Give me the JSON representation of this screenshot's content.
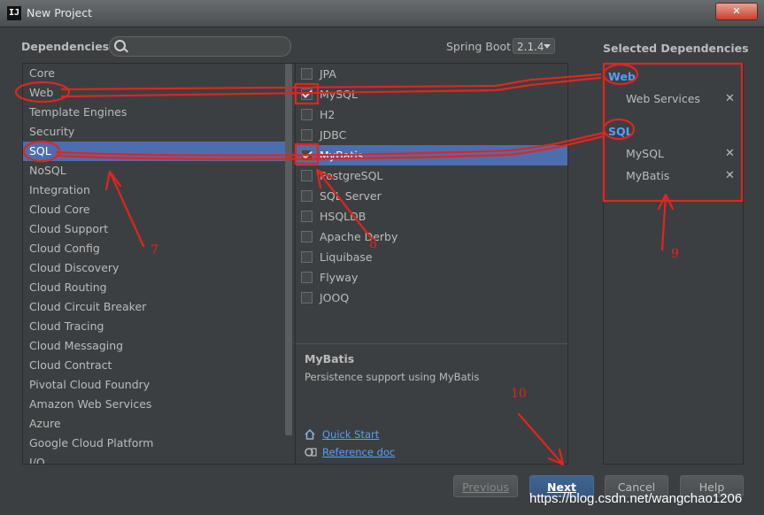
{
  "window": {
    "title": "New Project",
    "icon_text": "IJ",
    "close_label": "✕"
  },
  "header": {
    "dependencies_label": "Dependencies",
    "search_placeholder": "",
    "spring_boot_label": "Spring Boot",
    "spring_boot_version": "2.1.4"
  },
  "categories": [
    "Core",
    "Web",
    "Template Engines",
    "Security",
    "SQL",
    "NoSQL",
    "Integration",
    "Cloud Core",
    "Cloud Support",
    "Cloud Config",
    "Cloud Discovery",
    "Cloud Routing",
    "Cloud Circuit Breaker",
    "Cloud Tracing",
    "Cloud Messaging",
    "Cloud Contract",
    "Pivotal Cloud Foundry",
    "Amazon Web Services",
    "Azure",
    "Google Cloud Platform",
    "I/O"
  ],
  "selected_category": "SQL",
  "options": [
    {
      "label": "JPA",
      "checked": false
    },
    {
      "label": "MySQL",
      "checked": true
    },
    {
      "label": "H2",
      "checked": false
    },
    {
      "label": "JDBC",
      "checked": false
    },
    {
      "label": "MyBatis",
      "checked": true
    },
    {
      "label": "PostgreSQL",
      "checked": false
    },
    {
      "label": "SQL Server",
      "checked": false
    },
    {
      "label": "HSQLDB",
      "checked": false
    },
    {
      "label": "Apache Derby",
      "checked": false
    },
    {
      "label": "Liquibase",
      "checked": false
    },
    {
      "label": "Flyway",
      "checked": false
    },
    {
      "label": "JOOQ",
      "checked": false
    }
  ],
  "selected_option": "MyBatis",
  "description": {
    "title": "MyBatis",
    "text": "Persistence support using MyBatis",
    "quick_start": "Quick Start",
    "reference_doc": "Reference doc"
  },
  "selected_dependencies": {
    "title": "Selected Dependencies",
    "groups": [
      {
        "name": "Web",
        "items": [
          "Web Services"
        ]
      },
      {
        "name": "SQL",
        "items": [
          "MySQL",
          "MyBatis"
        ]
      }
    ],
    "remove_glyph": "✕"
  },
  "buttons": {
    "previous": "Previous",
    "next": "Next",
    "cancel": "Cancel",
    "help": "Help"
  },
  "annotations": {
    "n7": "7",
    "n8": "8",
    "n9": "9",
    "n10": "10"
  },
  "watermark": "https://blog.csdn.net/wangchao1206",
  "colors": {
    "background": "#3c3f41",
    "selection": "#4b6eaf",
    "link": "#589df6",
    "annotation": "#e0251f"
  }
}
